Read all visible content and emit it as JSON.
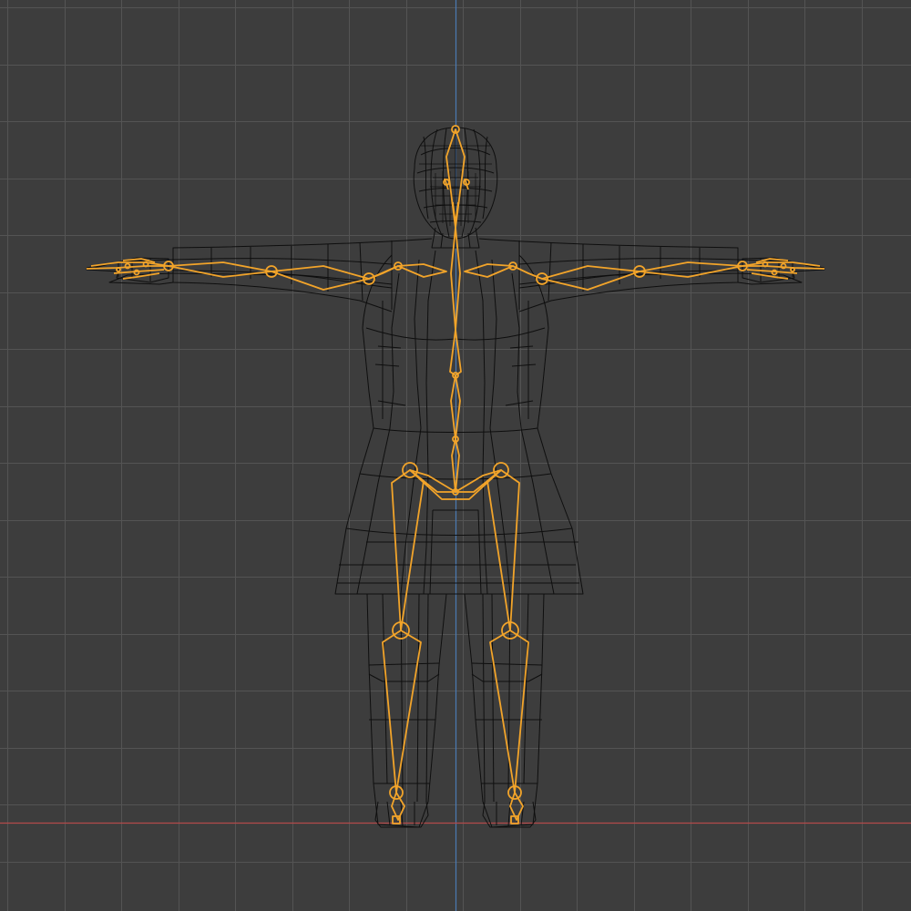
{
  "viewport": {
    "view": "front-orthographic",
    "background_color": "#3d3d3d",
    "grid_color": "#545454",
    "x_axis_color": "#b34a4a",
    "z_axis_color": "#4a7ab3",
    "mode": "wireframe"
  },
  "scene": {
    "mesh": {
      "name_icon": "character-mesh",
      "wire_color": "#0a0a0a",
      "pose": "t-pose"
    },
    "armature": {
      "name_icon": "armature-bones",
      "bone_color": "#f2a42a",
      "selected": true
    }
  }
}
